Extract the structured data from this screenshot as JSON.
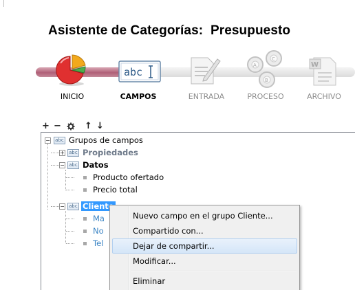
{
  "wizard": {
    "title": "Asistente de Categorías:  Presupuesto",
    "steps": [
      {
        "label": "INICIO",
        "state": "done",
        "icon": "pie-chart-icon"
      },
      {
        "label": "CAMPOS",
        "state": "active",
        "icon": "text-field-icon"
      },
      {
        "label": "ENTRADA",
        "state": "future",
        "icon": "document-pen-icon"
      },
      {
        "label": "PROCESO",
        "state": "future",
        "icon": "process-nodes-icon"
      },
      {
        "label": "ARCHIVO",
        "state": "future",
        "icon": "word-document-icon"
      }
    ]
  },
  "toolbar": {
    "add": "+",
    "remove": "−",
    "settings_icon": "gear-icon",
    "up": "↑",
    "down": "↓"
  },
  "tree": {
    "root": "Grupos de campos",
    "groups": [
      {
        "label": "Propiedades",
        "style": "grey",
        "expanded": false,
        "fields": []
      },
      {
        "label": "Datos",
        "style": "bold",
        "expanded": true,
        "fields": [
          "Producto ofertado",
          "Precio total"
        ]
      },
      {
        "label": "Cliente",
        "style": "selected",
        "expanded": true,
        "fields": [
          "Ma",
          "No",
          "Tel"
        ]
      }
    ]
  },
  "context_menu": {
    "items": [
      {
        "label": "Nuevo campo en el grupo Cliente..."
      },
      {
        "label": "Compartido con..."
      },
      {
        "label": "Dejar de compartir...",
        "highlighted": true
      },
      {
        "label": "Modificar..."
      },
      {
        "label": "Eliminar"
      }
    ]
  },
  "colors": {
    "progress_done": "#b06078",
    "selection": "#3399ff",
    "menu_highlight": "#d5e6f8"
  }
}
